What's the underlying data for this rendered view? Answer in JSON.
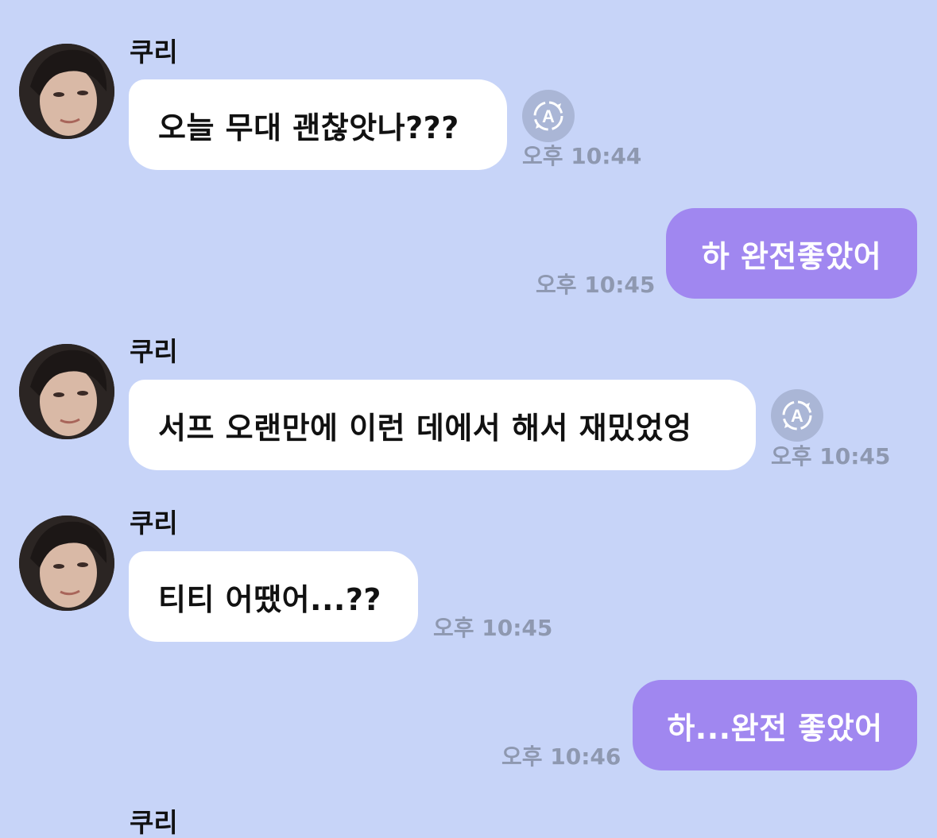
{
  "colors": {
    "background": "#c7d4f8",
    "incoming_bubble": "#ffffff",
    "outgoing_bubble": "#a087f0",
    "timestamp": "#8e98b0",
    "translate_icon": "#aab6d6"
  },
  "messages": [
    {
      "direction": "in",
      "sender": "쿠리",
      "text": "오늘 무대 괜찮앗나???",
      "time": "오후 10:44",
      "translate_icon": "translate-icon"
    },
    {
      "direction": "out",
      "text": "하 완전좋았어",
      "time": "오후 10:45"
    },
    {
      "direction": "in",
      "sender": "쿠리",
      "text": "서프 오랜만에 이런 데에서 해서 재밌었엉",
      "time": "오후 10:45",
      "translate_icon": "translate-icon"
    },
    {
      "direction": "in",
      "sender": "쿠리",
      "text": "티티 어땠어...??",
      "time": "오후 10:45"
    },
    {
      "direction": "out",
      "text": "하...완전 좋았어",
      "time": "오후 10:46"
    },
    {
      "direction": "in",
      "sender": "쿠리"
    }
  ]
}
